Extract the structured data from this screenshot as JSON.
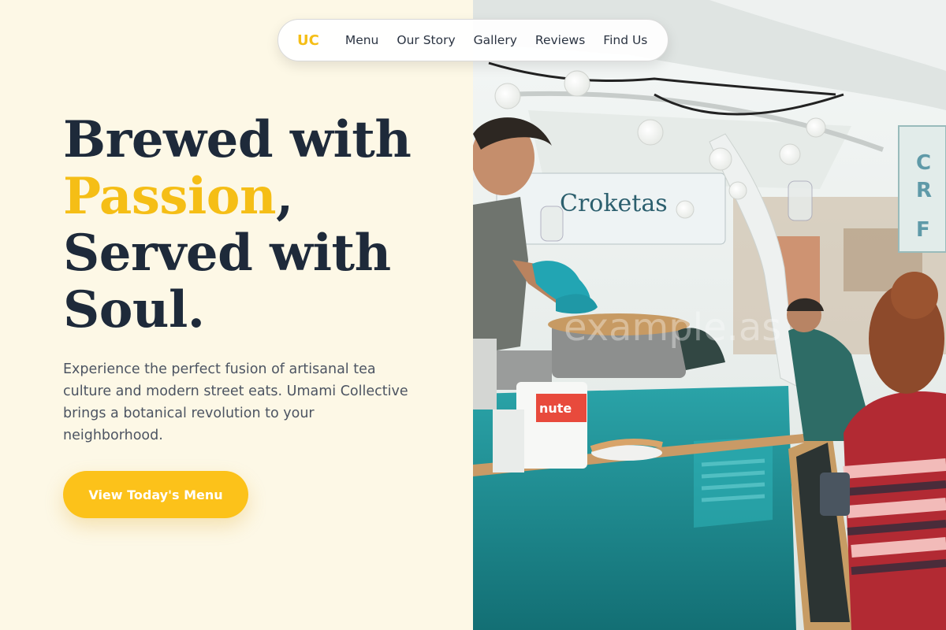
{
  "nav": {
    "logo": "UC",
    "links": [
      "Menu",
      "Our Story",
      "Gallery",
      "Reviews",
      "Find Us"
    ]
  },
  "hero": {
    "headline_line1": "Brewed with",
    "headline_accent": "Passion",
    "headline_comma": ",",
    "headline_line3": "Served with",
    "headline_line4": "Soul.",
    "description": "Experience the perfect fusion of artisanal tea culture and modern street eats. Umami Collective brings a botanical revolution to your neighborhood.",
    "cta_label": "View Today's Menu"
  },
  "photo": {
    "sign_text": "Croketas",
    "tub_label": "nute",
    "watermark": "example.as"
  },
  "colors": {
    "accent": "#f5be16",
    "headline": "#1e2a3a",
    "background": "#fdf8e6",
    "truck_teal": "#1e8c93"
  }
}
